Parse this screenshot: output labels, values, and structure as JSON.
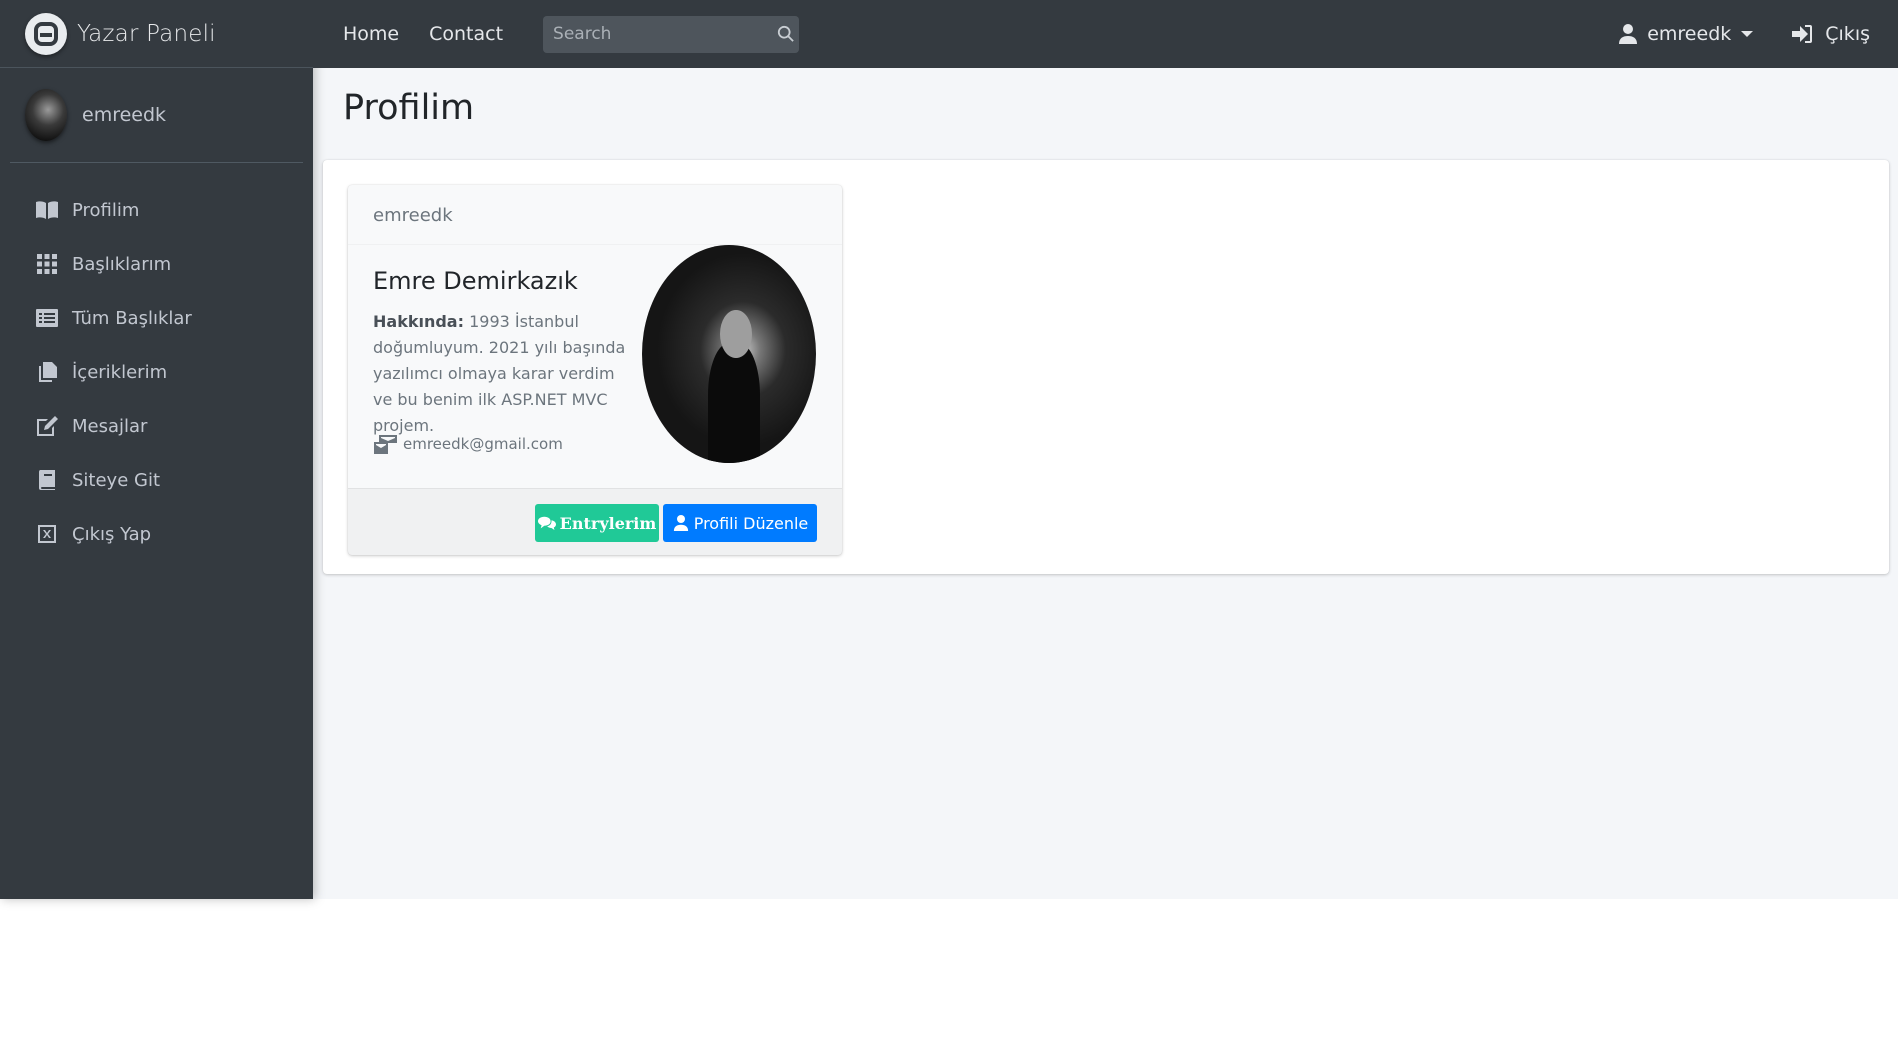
{
  "sidebar": {
    "brand": "Yazar Paneli",
    "user_name": "emreedk",
    "items": [
      {
        "label": "Profilim",
        "icon": "book-open-icon"
      },
      {
        "label": "Başlıklarım",
        "icon": "grid-icon"
      },
      {
        "label": "Tüm Başlıklar",
        "icon": "list-alt-icon"
      },
      {
        "label": "İçeriklerim",
        "icon": "copy-icon"
      },
      {
        "label": "Mesajlar",
        "icon": "edit-icon"
      },
      {
        "label": "Siteye Git",
        "icon": "book-icon"
      },
      {
        "label": "Çıkış Yap",
        "icon": "close-square-icon"
      }
    ]
  },
  "topbar": {
    "links": [
      "Home",
      "Contact"
    ],
    "search_placeholder": "Search",
    "user_menu": "emreedk",
    "logout": "Çıkış"
  },
  "page": {
    "title": "Profilim"
  },
  "profile_card": {
    "username": "emreedk",
    "full_name": "Emre Demirkazık",
    "about_label": "Hakkında:",
    "about_text": " 1993 İstanbul doğumluyum. 2021 yılı başında yazılımcı olmaya karar verdim ve bu benim ilk ASP.NET MVC projem.",
    "email": "emreedk@gmail.com",
    "entries_button": "Entrylerim",
    "edit_button": "Profili Düzenle"
  },
  "colors": {
    "sidebar_bg": "#343a40",
    "content_bg": "#f4f6f9",
    "entries_button": "#20c997",
    "edit_button": "#007bff"
  }
}
